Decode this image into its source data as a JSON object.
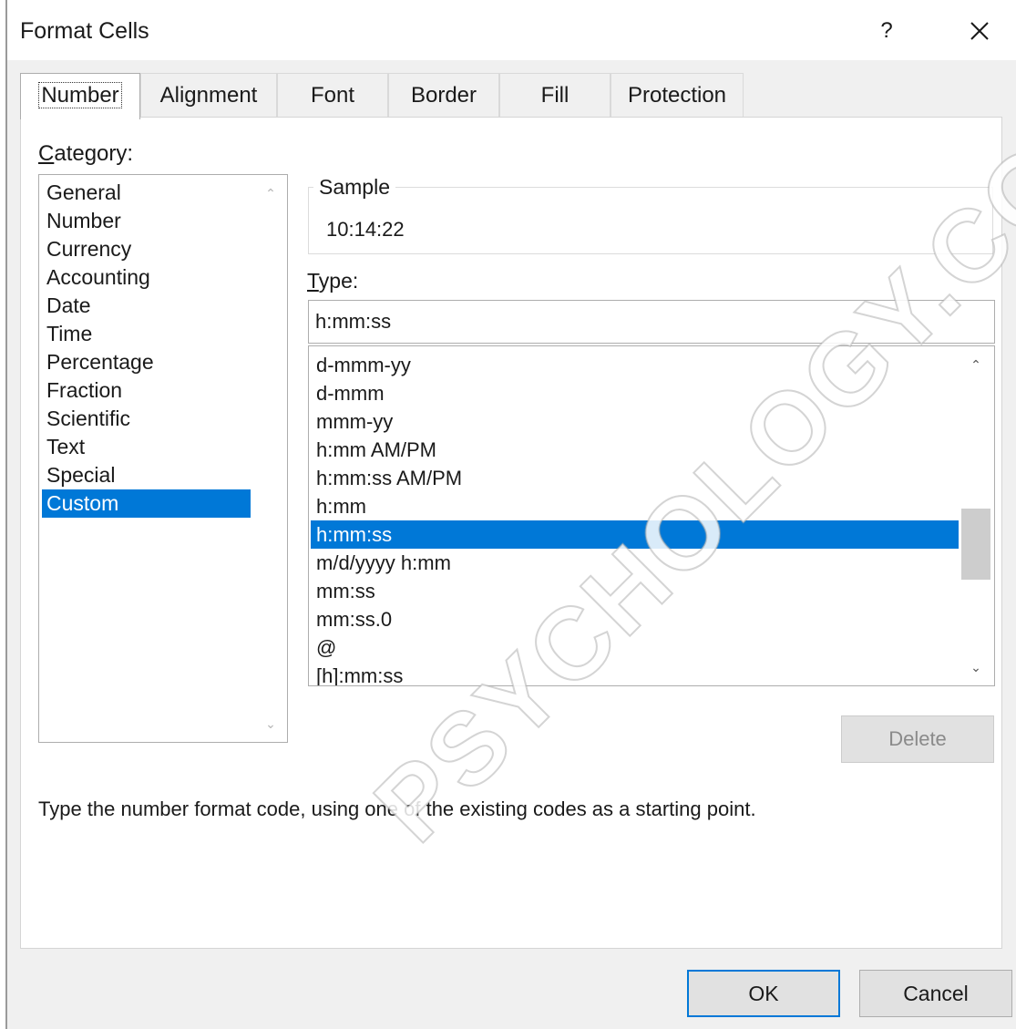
{
  "window": {
    "title": "Format Cells",
    "help_label": "?",
    "icons": {
      "close": "close-icon",
      "scroll_up": "chevron-up-icon",
      "scroll_down": "chevron-down-icon"
    }
  },
  "tabs": [
    {
      "label": "Number",
      "active": true
    },
    {
      "label": "Alignment"
    },
    {
      "label": "Font"
    },
    {
      "label": "Border"
    },
    {
      "label": "Fill"
    },
    {
      "label": "Protection"
    }
  ],
  "category": {
    "label_access": "C",
    "label_rest": "ategory:",
    "items": [
      "General",
      "Number",
      "Currency",
      "Accounting",
      "Date",
      "Time",
      "Percentage",
      "Fraction",
      "Scientific",
      "Text",
      "Special",
      "Custom"
    ],
    "selected": "Custom"
  },
  "sample": {
    "label": "Sample",
    "value": "10:14:22"
  },
  "type": {
    "label_access": "T",
    "label_rest": "ype:",
    "input_value": "h:mm:ss",
    "items": [
      "d-mmm-yy",
      "d-mmm",
      "mmm-yy",
      "h:mm AM/PM",
      "h:mm:ss AM/PM",
      "h:mm",
      "h:mm:ss",
      "m/d/yyyy h:mm",
      "mm:ss",
      "mm:ss.0",
      "@",
      "[h]:mm:ss"
    ],
    "selected": "h:mm:ss"
  },
  "buttons": {
    "delete": "Delete",
    "ok": "OK",
    "cancel": "Cancel"
  },
  "hint": "Type the number format code, using one of the existing codes as a starting point.",
  "watermark": "PSYCHOLOGY.COM",
  "colors": {
    "selection": "#0078d7",
    "dialog_bg": "#f0f0f0",
    "panel_bg": "#ffffff"
  }
}
